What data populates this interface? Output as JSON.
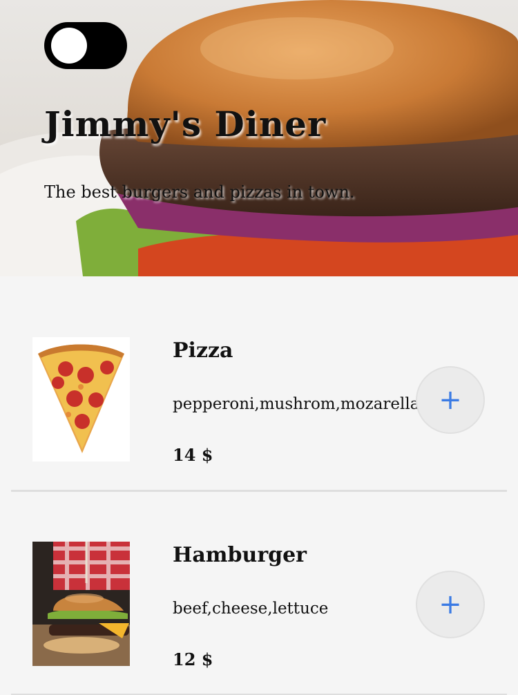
{
  "hero": {
    "title": "Jimmy's Diner",
    "subtitle": "The best burgers and pizzas in town.",
    "image": "burger-hero-photo",
    "toggle_state": "off"
  },
  "menu": {
    "items": [
      {
        "name": "Pizza",
        "ingredients": "pepperoni,mushrom,mozarella",
        "price": "14 $",
        "image": "pizza-slice-image",
        "add_label": "+"
      },
      {
        "name": "Hamburger",
        "ingredients": "beef,cheese,lettuce",
        "price": "12 $",
        "image": "hamburger-image",
        "add_label": "+"
      }
    ]
  },
  "colors": {
    "accent": "#3b7be4",
    "background": "#f5f5f5",
    "toggle": "#000000"
  }
}
